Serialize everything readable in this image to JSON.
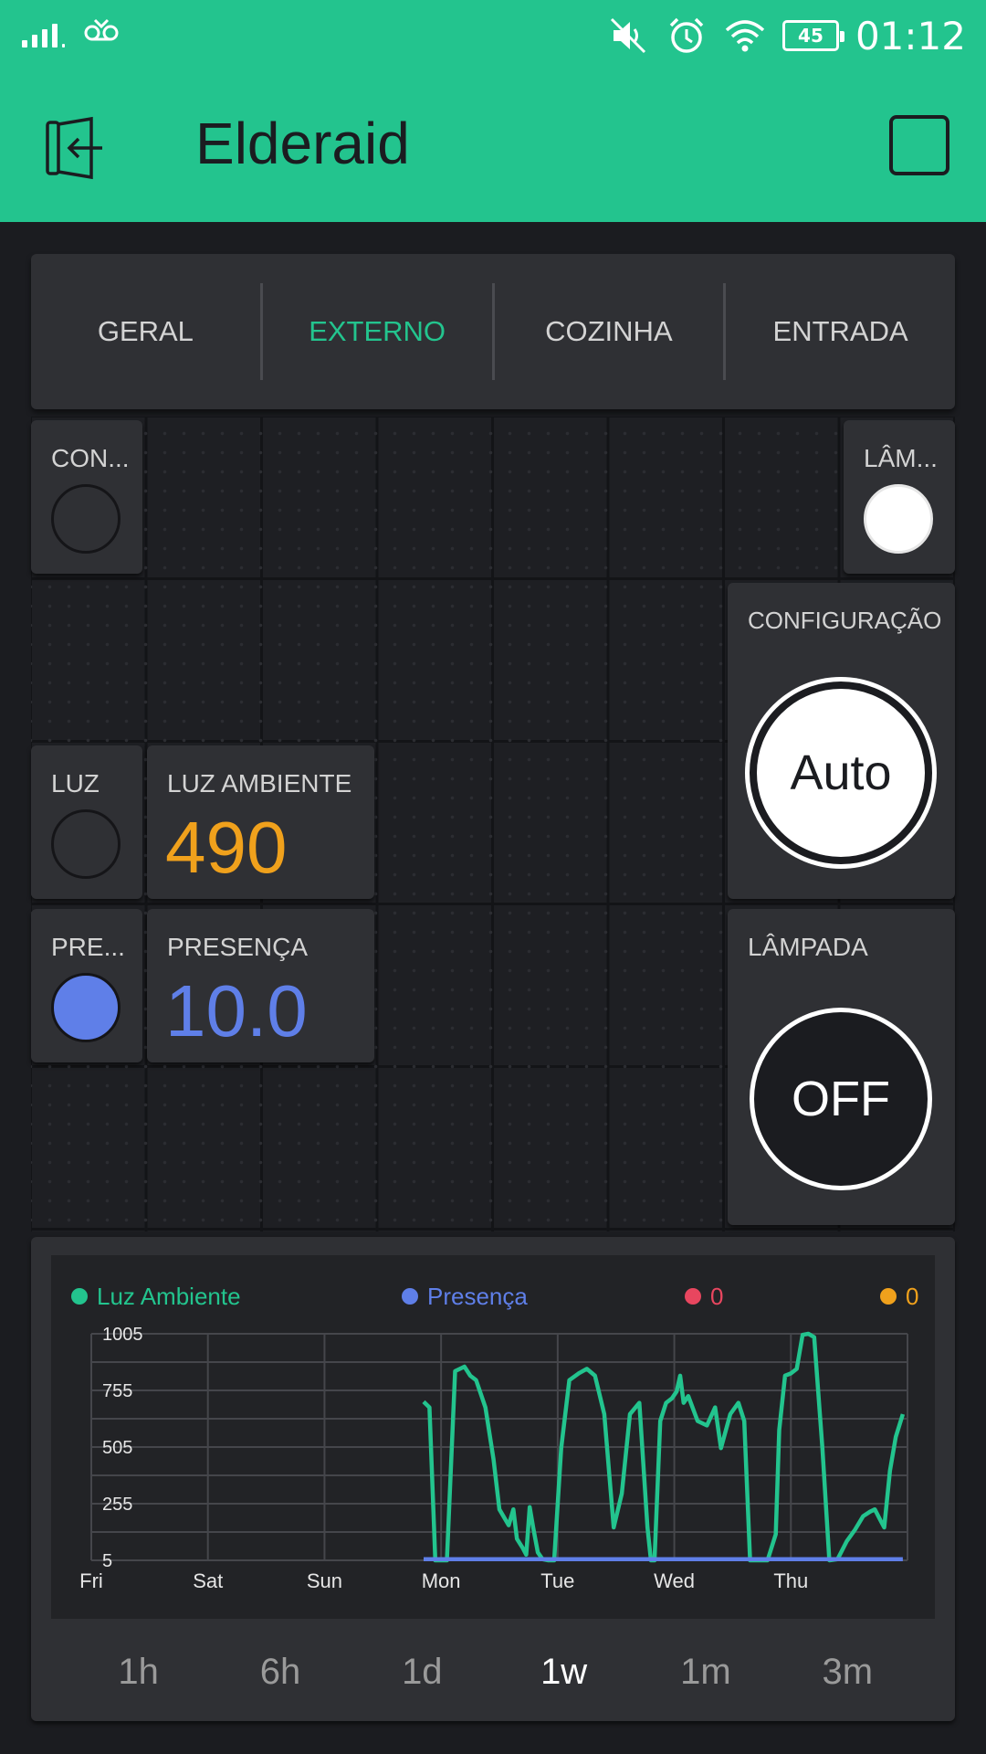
{
  "status_bar": {
    "voicemail_icon": "voicemail-icon",
    "battery": "45",
    "time": "01:12"
  },
  "app": {
    "title": "Elderaid"
  },
  "tabs": [
    {
      "label": "GERAL"
    },
    {
      "label": "EXTERNO"
    },
    {
      "label": "COZINHA"
    },
    {
      "label": "ENTRADA"
    }
  ],
  "widgets": {
    "con_led": {
      "label": "CON..."
    },
    "lamp_led": {
      "label": "LÂM..."
    },
    "configuracao": {
      "label": "CONFIGURAÇÃO",
      "button": "Auto"
    },
    "luz_led": {
      "label": "LUZ"
    },
    "luz_ambiente": {
      "label": "LUZ AMBIENTE",
      "value": "490",
      "color": "#f0a11c"
    },
    "pre_led": {
      "label": "PRE..."
    },
    "presenca": {
      "label": "PRESENÇA",
      "value": "10.0",
      "color": "#5f7fe8"
    },
    "lampada": {
      "label": "LÂMPADA",
      "button": "OFF"
    }
  },
  "chart_legend": [
    {
      "name": "Luz Ambiente",
      "color": "#23c48e"
    },
    {
      "name": "Presença",
      "color": "#5f7fe8"
    },
    {
      "name": "0",
      "color": "#e8465f"
    },
    {
      "name": "0",
      "color": "#f0a11c"
    }
  ],
  "chart_data": {
    "type": "line",
    "x_tick_labels": [
      "Fri",
      "Sat",
      "Sun",
      "Mon",
      "Tue",
      "Wed",
      "Thu"
    ],
    "y_tick_labels": [
      "1005",
      "755",
      "505",
      "255",
      "5"
    ],
    "ylim": [
      5,
      1005
    ],
    "grid": true,
    "legend_placement": "top",
    "series": [
      {
        "name": "Luz Ambiente",
        "color": "#23c48e",
        "x": [
          2.85,
          2.9,
          2.95,
          3.0,
          3.05,
          3.12,
          3.2,
          3.25,
          3.3,
          3.38,
          3.45,
          3.5,
          3.58,
          3.62,
          3.65,
          3.7,
          3.73,
          3.76,
          3.79,
          3.83,
          3.87,
          3.92,
          3.97,
          4.03,
          4.1,
          4.18,
          4.25,
          4.32,
          4.4,
          4.48,
          4.55,
          4.62,
          4.7,
          4.77,
          4.8,
          4.83,
          4.88,
          4.93,
          4.98,
          5.02,
          5.05,
          5.08,
          5.12,
          5.2,
          5.28,
          5.35,
          5.4,
          5.48,
          5.55,
          5.6,
          5.65,
          5.72,
          5.8,
          5.87,
          5.9,
          5.95,
          6.0,
          6.05,
          6.1,
          6.15,
          6.2,
          6.27,
          6.33,
          6.4,
          6.48,
          6.55,
          6.62,
          6.68,
          6.72,
          6.77,
          6.8,
          6.85,
          6.9,
          6.96
        ],
        "values": [
          705,
          680,
          5,
          5,
          5,
          840,
          860,
          820,
          800,
          680,
          450,
          230,
          160,
          230,
          100,
          60,
          30,
          240,
          150,
          40,
          10,
          5,
          5,
          500,
          800,
          830,
          850,
          820,
          650,
          150,
          300,
          650,
          700,
          150,
          5,
          5,
          620,
          700,
          720,
          750,
          820,
          700,
          730,
          620,
          600,
          680,
          500,
          650,
          700,
          620,
          5,
          5,
          5,
          120,
          580,
          820,
          830,
          850,
          1000,
          1005,
          990,
          500,
          5,
          10,
          90,
          140,
          200,
          220,
          230,
          180,
          150,
          400,
          550,
          650
        ]
      },
      {
        "name": "Presença",
        "color": "#5f7fe8",
        "x": [
          2.85,
          6.96
        ],
        "values": [
          10,
          10
        ]
      }
    ]
  },
  "time_ranges": [
    {
      "label": "1h"
    },
    {
      "label": "6h"
    },
    {
      "label": "1d"
    },
    {
      "label": "1w",
      "active": true
    },
    {
      "label": "1m"
    },
    {
      "label": "3m"
    }
  ]
}
